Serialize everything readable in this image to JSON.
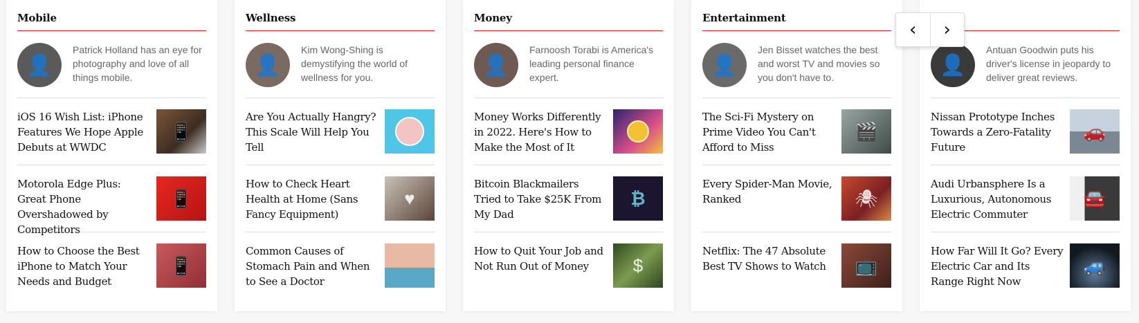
{
  "columns": [
    {
      "category": "Mobile",
      "author": {
        "bio": "Patrick Holland has an eye for photography and love of all things mobile.",
        "avatar_icon": "person-icon",
        "avatar_color": "#5a5a5a"
      },
      "stories": [
        {
          "headline": "iOS 16 Wish List: iPhone Features We Hope Apple Debuts at WWDC",
          "thumb_icon": "phone-icon",
          "thumb_color": "#6b4a33"
        },
        {
          "headline": "Motorola Edge Plus: Great Phone Overshadowed by Competitors",
          "thumb_icon": "phone-icon",
          "thumb_color": "#e01f1f"
        },
        {
          "headline": "How to Choose the Best iPhone to Match Your Needs and Budget",
          "thumb_icon": "phone-icon",
          "thumb_color": "#b8474a"
        }
      ]
    },
    {
      "category": "Wellness",
      "author": {
        "bio": "Kim Wong-Shing is demystifying the world of wellness for you.",
        "avatar_icon": "person-icon",
        "avatar_color": "#7a6a62"
      },
      "stories": [
        {
          "headline": "Are You Actually Hangry? This Scale Will Help You Tell",
          "thumb_icon": "scale-icon",
          "thumb_color": "#4fc6e6"
        },
        {
          "headline": "How to Check Heart Health at Home (Sans Fancy Equipment)",
          "thumb_icon": "heart-icon",
          "thumb_color": "#8a7567"
        },
        {
          "headline": "Common Causes of Stomach Pain and When to See a Doctor",
          "thumb_icon": "person-icon",
          "thumb_color": "#d9a890"
        }
      ]
    },
    {
      "category": "Money",
      "author": {
        "bio": "Farnoosh Torabi is America's leading personal finance expert.",
        "avatar_icon": "person-icon",
        "avatar_color": "#6e5a52"
      },
      "stories": [
        {
          "headline": "Money Works Differently in 2022. Here's How to Make the Most of It",
          "thumb_icon": "coin-icon",
          "thumb_color": "#3a3180"
        },
        {
          "headline": "Bitcoin Blackmailers Tried to Take $25K From My Dad",
          "thumb_icon": "bitcoin-icon",
          "thumb_color": "#1c1530"
        },
        {
          "headline": "How to Quit Your Job and Not Run Out of Money",
          "thumb_icon": "money-icon",
          "thumb_color": "#4d6b30"
        }
      ]
    },
    {
      "category": "Entertainment",
      "author": {
        "bio": "Jen Bisset watches the best and worst TV and movies so you don't have to.",
        "avatar_icon": "person-icon",
        "avatar_color": "#6a6a6a"
      },
      "stories": [
        {
          "headline": "The Sci-Fi Mystery on Prime Video You Can't Afford to Miss",
          "thumb_icon": "film-icon",
          "thumb_color": "#6b7a78"
        },
        {
          "headline": "Every Spider-Man Movie, Ranked",
          "thumb_icon": "film-icon",
          "thumb_color": "#a3302b"
        },
        {
          "headline": "Netflix: The 47 Absolute Best TV Shows to Watch",
          "thumb_icon": "tv-icon",
          "thumb_color": "#6e3a2e"
        }
      ]
    },
    {
      "category": "",
      "author": {
        "bio": "Antuan Goodwin puts his driver's license in jeopardy to deliver great reviews.",
        "avatar_icon": "person-icon",
        "avatar_color": "#3a3a3a"
      },
      "stories": [
        {
          "headline": "Nissan Prototype Inches Towards a Zero-Fatality Future",
          "thumb_icon": "car-icon",
          "thumb_color": "#8fa2b4"
        },
        {
          "headline": "Audi Urbansphere Is a Luxurious, Autonomous Electric Commuter",
          "thumb_icon": "car-icon",
          "thumb_color": "#4e4e4e"
        },
        {
          "headline": "How Far Will It Go? Every Electric Car and Its Range Right Now",
          "thumb_icon": "car-icon",
          "thumb_color": "#1f2a36"
        }
      ]
    }
  ],
  "carousel": {
    "prev_label": "‹",
    "next_label": "›"
  }
}
